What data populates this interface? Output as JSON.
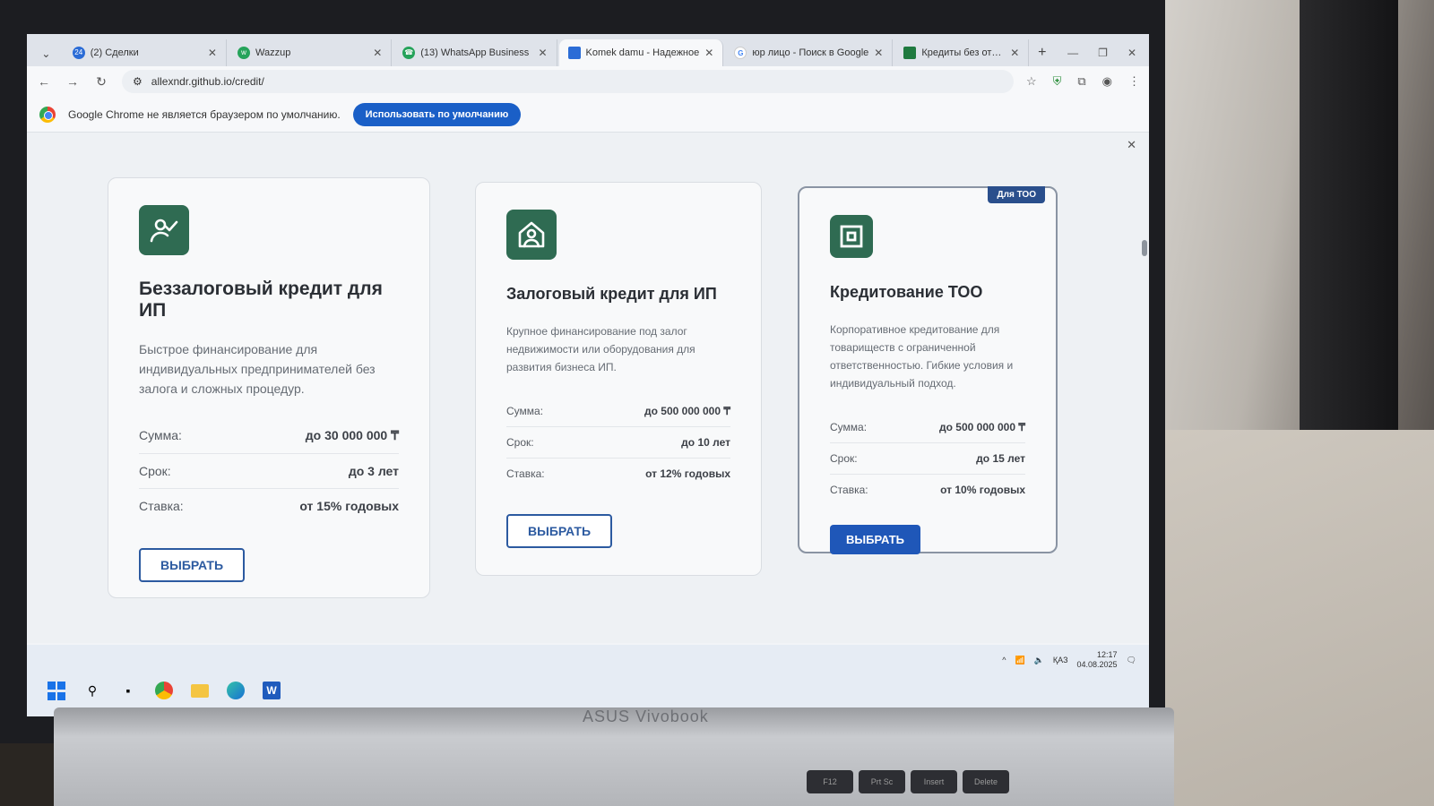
{
  "browser": {
    "tabs": [
      {
        "title": "(2) Сделки",
        "icon": "briefcase-icon"
      },
      {
        "title": "Wazzup",
        "icon": "wazzup-icon"
      },
      {
        "title": "(13) WhatsApp Business",
        "icon": "whatsapp-icon"
      },
      {
        "title": "Komek damu - Надежное",
        "icon": "site-icon",
        "active": true
      },
      {
        "title": "юр лицо - Поиск в Google",
        "icon": "google-icon"
      },
      {
        "title": "Кредиты без отказа в Ка",
        "icon": "doc-icon"
      }
    ],
    "url": "allexndr.github.io/credit/",
    "infobar_text": "Google Chrome не является браузером по умолчанию.",
    "infobar_button": "Использовать по умолчанию"
  },
  "cards": [
    {
      "icon": "person-check-icon",
      "title": "Беззалоговый кредит для ИП",
      "description": "Быстрое финансирование для индивидуальных предпринимателей без залога и сложных процедур.",
      "rows": [
        {
          "label": "Сумма:",
          "value": "до 30 000 000 ₸"
        },
        {
          "label": "Срок:",
          "value": "до 3 лет"
        },
        {
          "label": "Ставка:",
          "value": "от 15% годовых"
        }
      ],
      "button": "ВЫБРАТЬ"
    },
    {
      "icon": "house-person-icon",
      "title": "Залоговый кредит для ИП",
      "description": "Крупное финансирование под залог недвижимости или оборудования для развития бизнеса ИП.",
      "rows": [
        {
          "label": "Сумма:",
          "value": "до 500 000 000 ₸"
        },
        {
          "label": "Срок:",
          "value": "до 10 лет"
        },
        {
          "label": "Ставка:",
          "value": "от 12% годовых"
        }
      ],
      "button": "ВЫБРАТЬ"
    },
    {
      "icon": "building-icon",
      "badge": "Для ТОО",
      "title": "Кредитование ТОО",
      "description": "Корпоративное кредитование для товариществ с ограниченной ответственностью. Гибкие условия и индивидуальный подход.",
      "rows": [
        {
          "label": "Сумма:",
          "value": "до 500 000 000 ₸"
        },
        {
          "label": "Срок:",
          "value": "до 15 лет"
        },
        {
          "label": "Ставка:",
          "value": "от 10% годовых"
        }
      ],
      "button": "ВЫБРАТЬ"
    }
  ],
  "taskbar": {
    "lang": "ҚАЗ",
    "time": "12:17",
    "date": "04.08.2025"
  },
  "laptop": {
    "brand": "ASUS Vivobook",
    "keys": [
      "F12",
      "Prt Sc",
      "Insert",
      "Delete"
    ]
  }
}
